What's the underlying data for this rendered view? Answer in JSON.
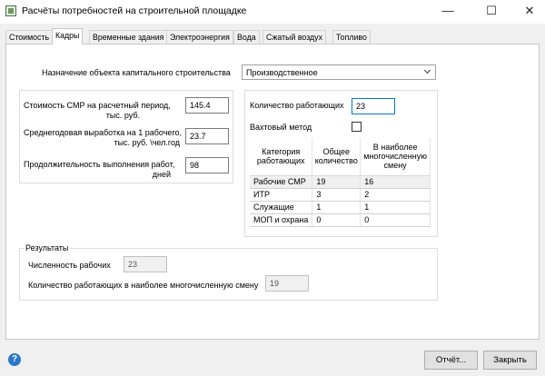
{
  "window": {
    "title": "Расчёты потребностей на строительной площадке",
    "minimize_glyph": "—",
    "maximize_glyph": "☐",
    "close_glyph": "✕"
  },
  "tabs": [
    {
      "label": "Стоимость",
      "active": false
    },
    {
      "label": "Кадры",
      "active": true
    },
    {
      "label": "Временные здания",
      "active": false
    },
    {
      "label": "Электроэнергия",
      "active": false
    },
    {
      "label": "Вода",
      "active": false
    },
    {
      "label": "Сжатый воздух",
      "active": false
    },
    {
      "label": "Топливо",
      "active": false
    }
  ],
  "purpose": {
    "label": "Назначение объекта капитального строительства",
    "value": "Производственное"
  },
  "inputs": {
    "smr_cost_label_1": "Стоимость СМР на расчетный период,",
    "smr_cost_label_2": "тыс. руб.",
    "smr_cost_value": "145.4",
    "output_label_1": "Среднегодовая выработка на 1 рабочего,",
    "output_label_2": "тыс. руб. \\чел.год",
    "output_value": "23.7",
    "duration_label_1": "Продолжительность выполнения работ,",
    "duration_label_2": "дней",
    "duration_value": "98"
  },
  "workers": {
    "count_label": "Количество работающих",
    "count_value": "23",
    "shift_label": "Вахтовый метод",
    "shift_checked": false
  },
  "table": {
    "headers": [
      "Категория работающих",
      "Общее количество",
      "В наиболее многочисленную смену"
    ],
    "rows": [
      [
        "Рабочие СМР",
        "19",
        "16"
      ],
      [
        "ИТР",
        "3",
        "2"
      ],
      [
        "Служащие",
        "1",
        "1"
      ],
      [
        "МОП и охрана",
        "0",
        "0"
      ]
    ]
  },
  "results": {
    "title": "Результаты",
    "workers_label": "Численность рабочих",
    "workers_value": "23",
    "max_shift_label": "Количество работающих в наиболее многочисленную смену",
    "max_shift_value": "19"
  },
  "buttons": {
    "report": "Отчёт...",
    "close": "Закрыть",
    "help_glyph": "?"
  }
}
